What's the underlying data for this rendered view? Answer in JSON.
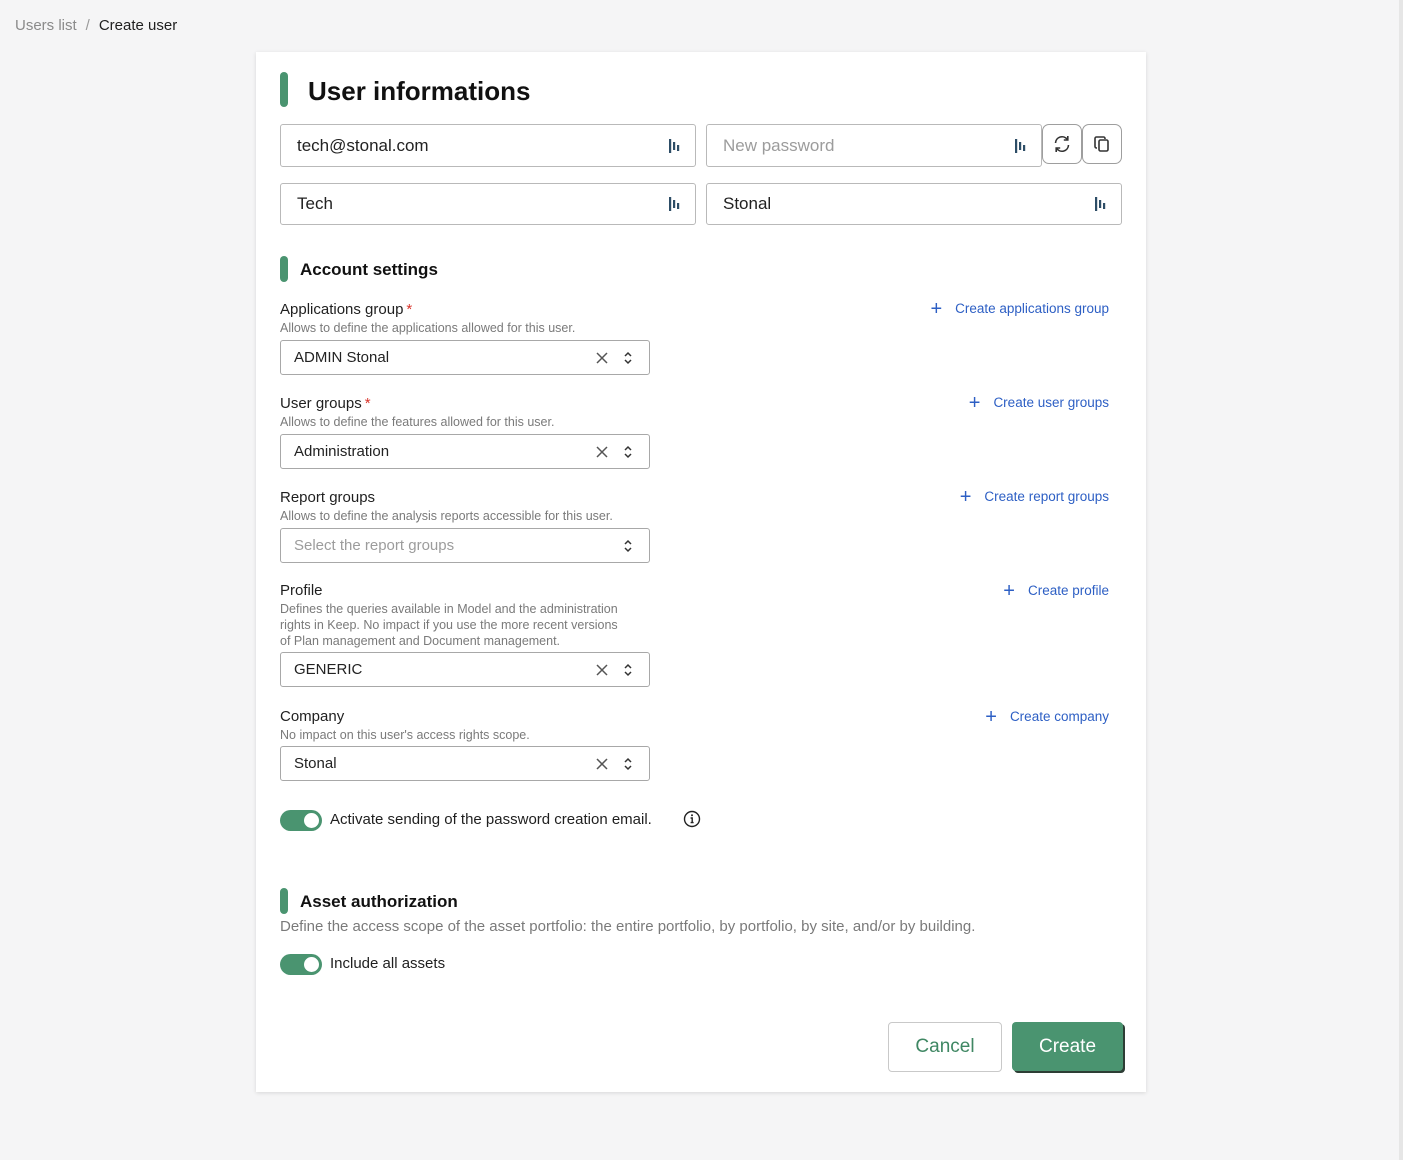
{
  "breadcrumb": {
    "parent": "Users list",
    "separator": "/",
    "current": "Create user"
  },
  "user_info": {
    "title": "User informations",
    "email_value": "tech@stonal.com",
    "password_placeholder": "New password",
    "first_name_value": "Tech",
    "last_name_value": "Stonal",
    "regenerate_icon": "refresh-icon",
    "copy_icon": "copy-icon"
  },
  "account_settings": {
    "title": "Account settings",
    "applications_group": {
      "label": "Applications group",
      "required_mark": "*",
      "help": "Allows to define the applications allowed for this user.",
      "value": "ADMIN Stonal",
      "create_label": "Create applications group"
    },
    "user_groups": {
      "label": "User groups",
      "required_mark": "*",
      "help": "Allows to define the features allowed for this user.",
      "value": "Administration",
      "create_label": "Create user groups"
    },
    "report_groups": {
      "label": "Report groups",
      "help": "Allows to define the analysis reports accessible for this user.",
      "placeholder": "Select the report groups",
      "create_label": "Create report groups"
    },
    "profile": {
      "label": "Profile",
      "help_line1": "Defines the queries available in Model and the administration",
      "help_line2": "rights in Keep. No impact if you use the more recent versions",
      "help_line3": "of Plan management and Document management.",
      "value": "GENERIC",
      "create_label": "Create profile"
    },
    "company": {
      "label": "Company",
      "help": "No impact on this user's access rights scope.",
      "value": "Stonal",
      "create_label": "Create company"
    },
    "email_toggle": {
      "label": "Activate sending of the password creation email.",
      "on": true
    }
  },
  "asset_authorization": {
    "title": "Asset authorization",
    "description": "Define the access scope of the asset portfolio: the entire portfolio, by portfolio, by site, and/or by building.",
    "include_all_label": "Include all assets",
    "include_all_on": true
  },
  "actions": {
    "cancel_label": "Cancel",
    "create_label": "Create"
  },
  "colors": {
    "accent_green": "#4a9470",
    "link_blue": "#2d5fc4",
    "required_red": "#d9342b"
  }
}
